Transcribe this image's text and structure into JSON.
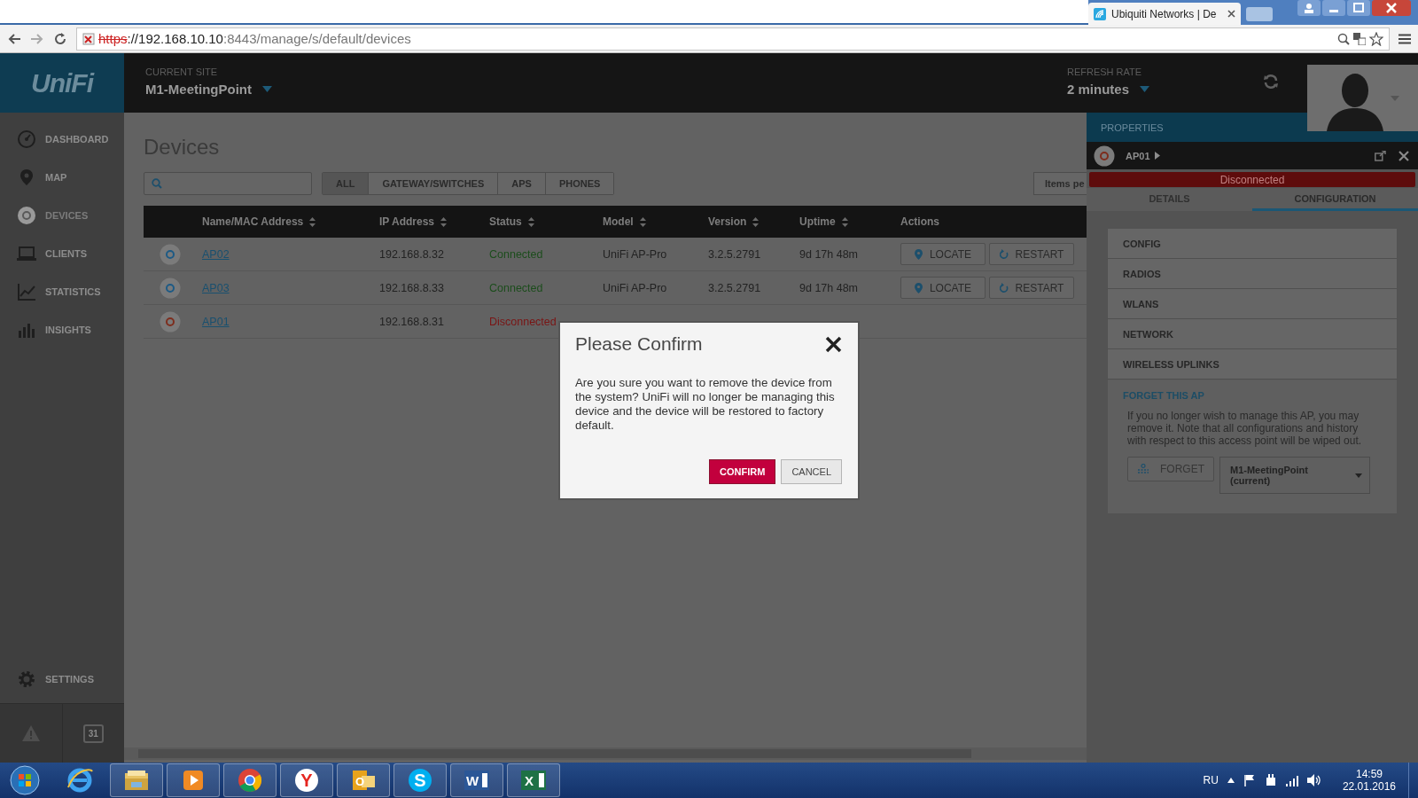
{
  "browser": {
    "tab_title": "Ubiquiti Networks | De",
    "url_scheme": "https",
    "url_host": "://192.168.10.10",
    "url_path": ":8443/manage/s/default/devices"
  },
  "header": {
    "logo": "UniFi",
    "site_label": "CURRENT SITE",
    "site": "M1-MeetingPoint",
    "refresh_label": "REFRESH RATE",
    "refresh": "2 minutes"
  },
  "sidebar": {
    "items": [
      {
        "label": "DASHBOARD",
        "kind": "dashboard",
        "selected": false
      },
      {
        "label": "MAP",
        "kind": "map",
        "selected": false
      },
      {
        "label": "DEVICES",
        "kind": "devices",
        "selected": true
      },
      {
        "label": "CLIENTS",
        "kind": "clients",
        "selected": false
      },
      {
        "label": "STATISTICS",
        "kind": "statistics",
        "selected": false
      },
      {
        "label": "INSIGHTS",
        "kind": "insights",
        "selected": false
      }
    ],
    "settings": "SETTINGS",
    "calendar_day": "31"
  },
  "page": {
    "title": "Devices",
    "filters": [
      {
        "label": "ALL",
        "selected": true
      },
      {
        "label": "GATEWAY/SWITCHES",
        "selected": false
      },
      {
        "label": "APS",
        "selected": false
      },
      {
        "label": "PHONES",
        "selected": false
      }
    ],
    "items_per_page": "Items pe"
  },
  "table": {
    "columns": [
      {
        "label": "Name/MAC Address",
        "sortable": true
      },
      {
        "label": "IP Address",
        "sortable": true
      },
      {
        "label": "Status",
        "sortable": true
      },
      {
        "label": "Model",
        "sortable": true
      },
      {
        "label": "Version",
        "sortable": true
      },
      {
        "label": "Uptime",
        "sortable": true
      },
      {
        "label": "Actions",
        "sortable": false
      }
    ],
    "rows": [
      {
        "name": "AP02",
        "ip": "192.168.8.32",
        "status": "Connected",
        "connected": true,
        "model": "UniFi AP-Pro",
        "version": "3.2.5.2791",
        "uptime": "9d 17h 48m",
        "actions": [
          "LOCATE",
          "RESTART"
        ]
      },
      {
        "name": "AP03",
        "ip": "192.168.8.33",
        "status": "Connected",
        "connected": true,
        "model": "UniFi AP-Pro",
        "version": "3.2.5.2791",
        "uptime": "9d 17h 48m",
        "actions": [
          "LOCATE",
          "RESTART"
        ]
      },
      {
        "name": "AP01",
        "ip": "192.168.8.31",
        "status": "Disconnected",
        "connected": false
      }
    ]
  },
  "properties": {
    "title": "PROPERTIES",
    "device": "AP01",
    "status": "Disconnected",
    "connected": false,
    "tabs": [
      {
        "label": "DETAILS",
        "selected": false
      },
      {
        "label": "CONFIGURATION",
        "selected": true
      }
    ],
    "sections": [
      "CONFIG",
      "RADIOS",
      "WLANS",
      "NETWORK",
      "WIRELESS UPLINKS"
    ],
    "forget": {
      "title": "FORGET THIS AP",
      "text": "If you no longer wish to manage this AP, you may remove it. Note that all configurations and history with respect to this access point will be wiped out.",
      "button": "FORGET",
      "site_select": "M1-MeetingPoint (current)"
    }
  },
  "dialog": {
    "title": "Please Confirm",
    "message": "Are you sure you want to remove the device from the system? UniFi will no longer be managing this device and the device will be restored to factory default.",
    "confirm": "CONFIRM",
    "cancel": "CANCEL"
  },
  "taskbar": {
    "apps": [
      {
        "kind": "ie",
        "running": false
      },
      {
        "kind": "explorer",
        "running": true
      },
      {
        "kind": "media",
        "running": true
      },
      {
        "kind": "chrome",
        "running": true
      },
      {
        "kind": "yandex",
        "running": true,
        "glyph": "Y"
      },
      {
        "kind": "outlook",
        "running": true,
        "glyph": "O"
      },
      {
        "kind": "skype",
        "running": true,
        "glyph": "S"
      },
      {
        "kind": "word",
        "running": true,
        "glyph": "W"
      },
      {
        "kind": "excel",
        "running": true,
        "glyph": "X"
      }
    ],
    "language": "RU",
    "time": "14:59",
    "date": "22.01.2016"
  }
}
